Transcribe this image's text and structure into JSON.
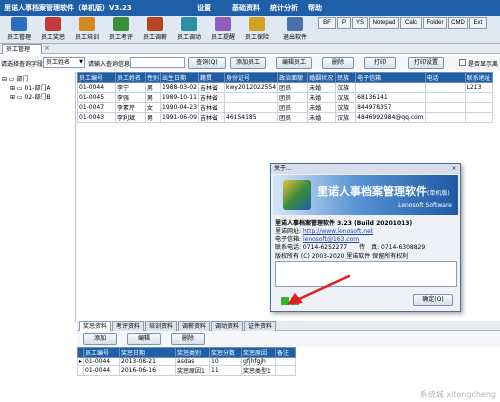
{
  "app": {
    "title": "里诺人事档案管理软件（单机版）V3.23",
    "menu": [
      "设置",
      "基础资料",
      "统计分析",
      "帮助"
    ]
  },
  "toolbar": {
    "buttons": [
      {
        "label": "员工管理",
        "color": "#2f6fbf",
        "icon": "people-icon"
      },
      {
        "label": "员工奖惩",
        "color": "#c23b3b",
        "icon": "award-icon"
      },
      {
        "label": "员工培训",
        "color": "#d28a1f",
        "icon": "training-icon"
      },
      {
        "label": "员工考评",
        "color": "#3b8f3b",
        "icon": "evaluation-icon"
      },
      {
        "label": "员工调薪",
        "color": "#b5451f",
        "icon": "salary-icon"
      },
      {
        "label": "员工调动",
        "color": "#2f8fa8",
        "icon": "transfer-icon"
      },
      {
        "label": "员工提醒",
        "color": "#8f5fbf",
        "icon": "reminder-icon"
      },
      {
        "label": "员工保险",
        "color": "#d0a020",
        "icon": "insurance-icon"
      },
      {
        "label": "退出软件",
        "color": "#4a6fa8",
        "icon": "exit-icon"
      }
    ],
    "quick": [
      "BF",
      "P",
      "YS",
      "Notepad",
      "Calc",
      "Folder",
      "CMD",
      "Ext"
    ]
  },
  "tabs": {
    "active": "员工管理",
    "close": "×"
  },
  "search": {
    "field_label": "请选择查询字段",
    "field_value": "员工姓名",
    "keyword_label": "请输入查询信息",
    "query_btn": "查询(Q)",
    "add_btn": "添加员工",
    "edit_btn": "编辑员工",
    "delete_btn": "删除",
    "print_btn": "打印",
    "print_setup_btn": "打印设置",
    "show_resigned": "是否显示离"
  },
  "tree": {
    "root": "部门",
    "children": [
      "01-部门A",
      "02-部门B"
    ]
  },
  "employees": {
    "columns": [
      "员工编号",
      "员工姓名",
      "性别",
      "出生日期",
      "籍贯",
      "身份证号",
      "政治面貌",
      "婚姻状况",
      "民族",
      "电子信箱",
      "电话",
      "联系地址"
    ],
    "rows": [
      [
        "01-0044",
        "李宁",
        "男",
        "1988-03-02",
        "吉林省",
        "kwy2012022554",
        "团员",
        "未婚",
        "汉族",
        "",
        "",
        "L213"
      ],
      [
        "01-0045",
        "李强",
        "男",
        "1989-10-11",
        "吉林省",
        "",
        "团员",
        "未婚",
        "汉族",
        "68136141",
        "",
        ""
      ],
      [
        "01-0047",
        "李素芹",
        "女",
        "1990-04-23",
        "吉林省",
        "",
        "团员",
        "未婚",
        "汉族",
        "844978357",
        "",
        ""
      ],
      [
        "01-0043",
        "李利斌",
        "男",
        "1991-06-09",
        "吉林省",
        "46154185",
        "团员",
        "未婚",
        "汉族",
        "4846992984@qq.com",
        "",
        ""
      ]
    ]
  },
  "bottom": {
    "tabs": [
      "奖惩资料",
      "考评资料",
      "培训资料",
      "调薪资料",
      "调动资料",
      "证件资料"
    ],
    "add_btn": "添加",
    "edit_btn": "编辑",
    "delete_btn": "删除",
    "columns": [
      "员工编号",
      "奖惩日期",
      "奖惩类别",
      "奖惩分数",
      "奖惩原因",
      "备注"
    ],
    "rows": [
      [
        "01-0044",
        "2013-08-21",
        "asdas",
        "10",
        "gfjhfgjh",
        ""
      ],
      [
        "01-0044",
        "2016-06-16",
        "奖惩原因1",
        "11",
        "奖惩类型1",
        ""
      ]
    ]
  },
  "about": {
    "title": "关于...",
    "close": "×",
    "banner_title": "里诺人事档案管理软件",
    "banner_sub": "(单机版)",
    "banner_company": "Lenosoft Software",
    "product": "里诺人事档案管理软件 3.23 (Build 20201013)",
    "website_label": "里诺网址:",
    "website": "http://www.lenosoft.net",
    "email_label": "电子信箱:",
    "email": "lenosoft@163.com",
    "phone_label": "联系电话: 0714-6252277",
    "fax": "传　真: 0714-6308829",
    "copyright": "版权所有 (C) 2003-2020 里诺软件 保留所有权利",
    "ok_btn": "确定(O)"
  },
  "watermark": "系统城 xitongcheng"
}
